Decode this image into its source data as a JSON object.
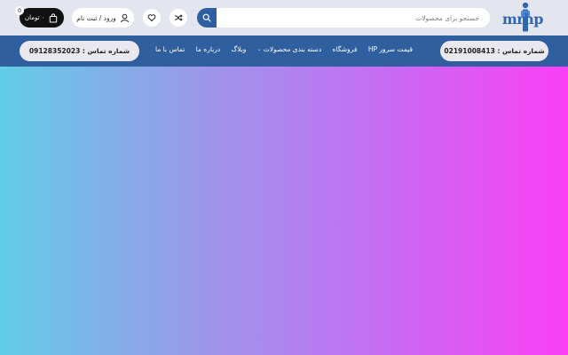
{
  "header": {
    "logo_text": "mrhp",
    "search": {
      "placeholder": "جستجو برای محصولات"
    },
    "login_label": "ورود / ثبت نام",
    "cart": {
      "total": "۰ تومان",
      "count": "0"
    },
    "icons": {
      "search": "search-icon",
      "compare": "shuffle-icon",
      "wishlist": "heart-icon",
      "user": "user-icon",
      "cart": "shopping-bag-icon"
    }
  },
  "nav": {
    "phone_right": "شماره تماس : 02191008413",
    "phone_left": "شماره تماس : 09128352023",
    "items": [
      {
        "label": "قیمت سرور HP"
      },
      {
        "label": "فروشگاه"
      },
      {
        "label": "دسته بندی محصولات"
      },
      {
        "label": "وبلاگ"
      },
      {
        "label": "درباره ما"
      },
      {
        "label": "تماس با ما"
      }
    ]
  },
  "colors": {
    "nav_bg": "#2f5f9e",
    "logo_blue": "#2f67b3",
    "hero_gradient_start": "#62cde6",
    "hero_gradient_end": "#fb3ff5"
  }
}
